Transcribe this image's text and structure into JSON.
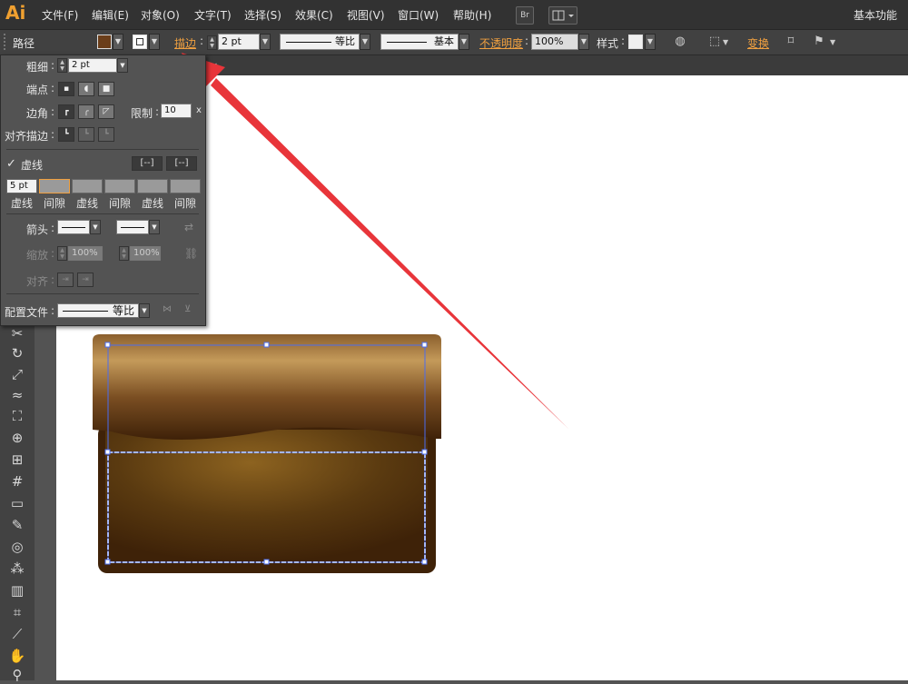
{
  "app": {
    "logo": "Ai",
    "workspace": "基本功能"
  },
  "menu": [
    "文件(F)",
    "编辑(E)",
    "对象(O)",
    "文字(T)",
    "选择(S)",
    "效果(C)",
    "视图(V)",
    "窗口(W)",
    "帮助(H)"
  ],
  "menubar_buttons": {
    "bridge": "Br",
    "arrange": "arrange-documents-icon"
  },
  "control": {
    "object_type": "路径",
    "stroke_label": "描边",
    "stroke_weight": "2 pt",
    "profile": "等比",
    "brush": "基本",
    "opacity_label": "不透明度",
    "opacity": "100%",
    "style_label": "样式",
    "transform_label": "变换",
    "fill_color": "#6b3e1a",
    "stroke_color": "#ffffff"
  },
  "stroke_panel": {
    "weight_label": "粗细",
    "weight": "2 pt",
    "cap_label": "端点",
    "corner_label": "边角",
    "limit_label": "限制",
    "limit": "10",
    "limit_unit": "x",
    "align_label": "对齐描边",
    "dashed_label": "虚线",
    "dashed_checked": true,
    "dash_values": [
      "5 pt",
      "",
      "",
      "",
      "",
      ""
    ],
    "dash_labels": [
      "虚线",
      "间隙",
      "虚线",
      "间隙",
      "虚线",
      "间隙"
    ],
    "arrow_label": "箭头",
    "scale_label": "缩放",
    "scale_start": "100%",
    "scale_end": "100%",
    "arrow_align_label": "对齐",
    "profile_label": "配置文件",
    "profile_value": "等比"
  },
  "tab": {
    "close": "×"
  },
  "colors": {
    "accent": "#f0a040",
    "arrow": "#e8353a",
    "selection": "#4a6cf0"
  }
}
